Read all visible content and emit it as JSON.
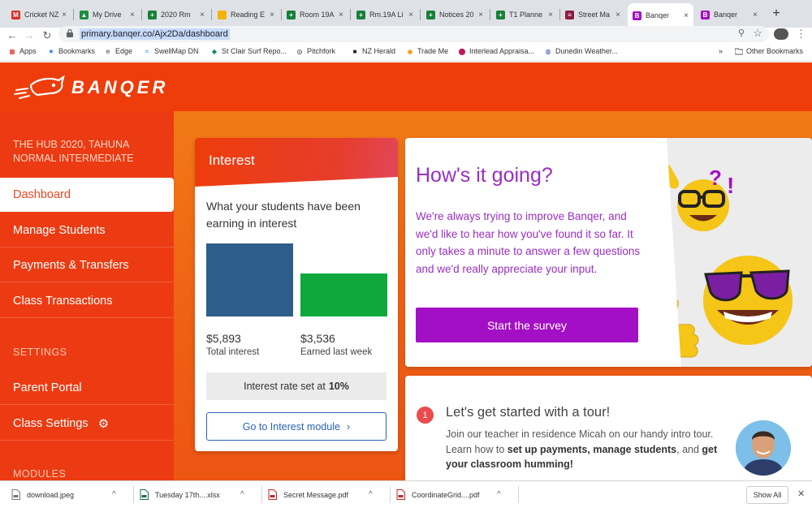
{
  "browser": {
    "tabs": [
      {
        "title": "Cricket NZ",
        "icon": "gmail-icon",
        "color": "#d93025",
        "glyph": "M"
      },
      {
        "title": "My Drive",
        "icon": "drive-icon",
        "color": "#1e8e3e",
        "glyph": "▲"
      },
      {
        "title": "2020 Rm",
        "icon": "sheets-icon",
        "color": "#188038",
        "glyph": "+"
      },
      {
        "title": "Reading E",
        "icon": "slides-icon",
        "color": "#f4b400",
        "glyph": ""
      },
      {
        "title": "Room 19A",
        "icon": "sheets-icon",
        "color": "#188038",
        "glyph": "+"
      },
      {
        "title": "Rm.19A Li",
        "icon": "sheets-icon",
        "color": "#188038",
        "glyph": "+"
      },
      {
        "title": "Notices 20",
        "icon": "sheets-icon",
        "color": "#188038",
        "glyph": "+"
      },
      {
        "title": "T1 Planne",
        "icon": "sheets-icon",
        "color": "#188038",
        "glyph": "+"
      },
      {
        "title": "Street Ma",
        "icon": "site-icon",
        "color": "#8b1d41",
        "glyph": "≡"
      },
      {
        "title": "Banqer",
        "icon": "banqer-icon",
        "color": "#a30fc4",
        "glyph": "B"
      },
      {
        "title": "Banqer",
        "icon": "banqer-icon",
        "color": "#a30fc4",
        "glyph": "B"
      }
    ],
    "url": "primary.banqer.co/Ajx2Da/dashboard",
    "bookmarks": [
      {
        "label": "Apps",
        "icon": "apps-grid-icon"
      },
      {
        "label": "Bookmarks",
        "icon": "star-icon"
      },
      {
        "label": "Edge",
        "icon": "edge-icon"
      },
      {
        "label": "SwellMap DN",
        "icon": "swellmap-icon"
      },
      {
        "label": "St Clair Surf Repo...",
        "icon": "surf-icon"
      },
      {
        "label": "Pitchfork",
        "icon": "pitchfork-icon"
      },
      {
        "label": "NZ Herald",
        "icon": "herald-icon"
      },
      {
        "label": "Trade Me",
        "icon": "trademe-icon"
      },
      {
        "label": "Interlead Appraisa...",
        "icon": "interlead-icon"
      },
      {
        "label": "Dunedin Weather...",
        "icon": "weather-icon"
      }
    ],
    "other_bookmarks": "Other Bookmarks",
    "overflow": "»"
  },
  "app": {
    "brand": "BANQER",
    "school": "THE HUB 2020, TAHUNA NORMAL INTERMEDIATE",
    "nav": {
      "dashboard": "Dashboard",
      "manage_students": "Manage Students",
      "payments": "Payments & Transfers",
      "class_transactions": "Class Transactions",
      "settings_title": "SETTINGS",
      "parent_portal": "Parent Portal",
      "class_settings": "Class Settings",
      "modules_title": "MODULES"
    },
    "interest": {
      "title": "Interest",
      "subtitle": "What your students have been earning in interest",
      "total_value": "$5,893",
      "total_label": "Total interest",
      "week_value": "$3,536",
      "week_label": "Earned last week",
      "rate_prefix": "Interest rate set at",
      "rate_value": "10%",
      "button": "Go to Interest module",
      "chevron": "›",
      "colors": {
        "total": "#2d5d8a",
        "week": "#0fa83c"
      }
    },
    "survey": {
      "title": "How's it going?",
      "text": "We're always trying to improve Banqer, and we'd like to hear how you've found it so far. It only takes a minute to answer a few questions and we'd really appreciate your input.",
      "button": "Start the survey"
    },
    "tour": {
      "step": "1",
      "title": "Let's get started with a tour!",
      "text_1": "Join our teacher in residence Micah on our handy intro tour. Learn how to ",
      "bold_1": "set up payments, manage students",
      "text_2": ", and ",
      "bold_2": "get your classroom humming!"
    }
  },
  "downloads": {
    "items": [
      {
        "name": "download.jpeg",
        "icon": "image-file-icon"
      },
      {
        "name": "Tuesday 17th....xlsx",
        "icon": "excel-file-icon"
      },
      {
        "name": "Secret Message.pdf",
        "icon": "pdf-file-icon"
      },
      {
        "name": "CoordinateGrid....pdf",
        "icon": "pdf-file-icon"
      }
    ],
    "show_all": "Show All",
    "close": "✕",
    "caret": "^"
  }
}
